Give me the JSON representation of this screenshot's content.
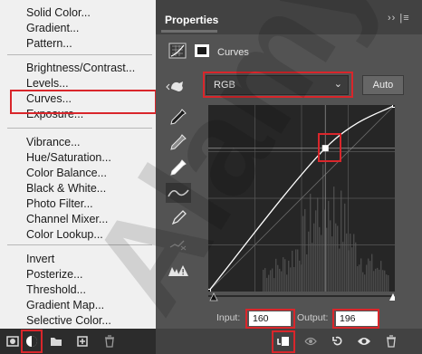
{
  "menu": {
    "groups": [
      [
        "Solid Color...",
        "Gradient...",
        "Pattern..."
      ],
      [
        "Brightness/Contrast...",
        "Levels...",
        "Curves...",
        "Exposure..."
      ],
      [
        "Vibrance...",
        "Hue/Saturation...",
        "Color Balance...",
        "Black & White...",
        "Photo Filter...",
        "Channel Mixer...",
        "Color Lookup..."
      ],
      [
        "Invert",
        "Posterize...",
        "Threshold...",
        "Gradient Map...",
        "Selective Color..."
      ]
    ],
    "highlighted": "Curves..."
  },
  "properties": {
    "title": "Properties",
    "menu_glyph": "›› |≡",
    "adjustment_label": "Curves",
    "channel": "RGB",
    "auto_label": "Auto",
    "input_label": "Input:",
    "input_value": "160",
    "output_label": "Output:",
    "output_value": "196"
  },
  "curve": {
    "points": [
      [
        0,
        0
      ],
      [
        160,
        196
      ],
      [
        255,
        255
      ]
    ],
    "selected_point": [
      160,
      196
    ]
  },
  "watermark_text": "Alamy",
  "colors": {
    "highlight": "#d9262b",
    "panel_bg": "#535353",
    "graph_bg": "#262626"
  }
}
